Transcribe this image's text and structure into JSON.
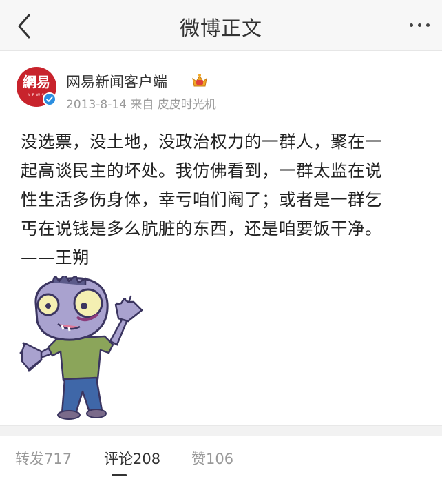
{
  "nav": {
    "title": "微博正文",
    "back_icon": "chevron-left-icon",
    "more_icon": "more-horizontal-icon"
  },
  "post": {
    "author": {
      "name": "网易新闻客户端",
      "avatar_text": "網易",
      "avatar_subtext": "NEWS",
      "avatar_color": "#c8232c",
      "verified_color": "#2b8ee0",
      "badge_icon": "crown-icon"
    },
    "meta": "2013-8-14 来自 皮皮时光机",
    "content_lines": [
      "没选票，没土地，没政治权力的一群人，聚在一",
      "起高谈民主的坏处。我仿佛看到，一群太监在说",
      "性生活多伤身体，幸亏咱们阉了；或者是一群乞",
      "丐在说钱是多么肮脏的东西，还是咱要饭干净。",
      "——王朔"
    ],
    "image": "zombie-cartoon-illustration"
  },
  "tabs": [
    {
      "label": "转发717",
      "active": false
    },
    {
      "label": "评论208",
      "active": true
    },
    {
      "label": "赞106",
      "active": false
    }
  ]
}
